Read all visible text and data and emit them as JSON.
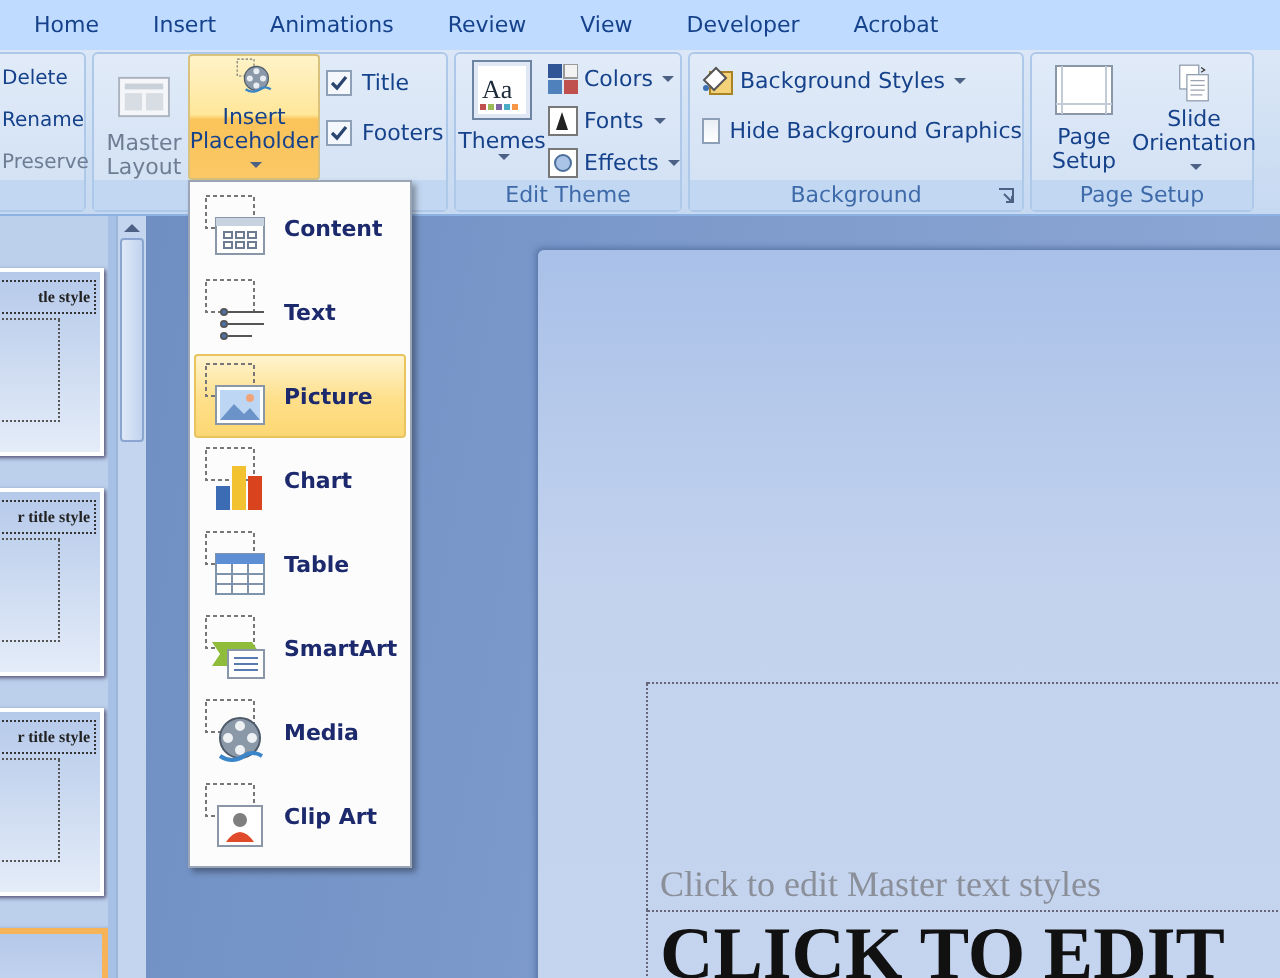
{
  "ribbon_tabs": [
    {
      "label": "Home",
      "selected": false
    },
    {
      "label": "Insert",
      "selected": false
    },
    {
      "label": "Animations",
      "selected": false
    },
    {
      "label": "Review",
      "selected": false
    },
    {
      "label": "View",
      "selected": false
    },
    {
      "label": "Developer",
      "selected": false
    },
    {
      "label": "Acrobat",
      "selected": false
    }
  ],
  "edit_master_group": {
    "buttons": [
      {
        "label": "Delete",
        "disabled": false
      },
      {
        "label": "Rename",
        "disabled": false
      },
      {
        "label": "Preserve",
        "disabled": true
      }
    ]
  },
  "master_layout_group": {
    "master_layout": {
      "label": "Master Layout",
      "disabled": true
    },
    "insert_placeholder": {
      "label": "Insert Placeholder",
      "pressed": true
    },
    "checkboxes": [
      {
        "label": "Title",
        "checked": true
      },
      {
        "label": "Footers",
        "checked": true
      }
    ]
  },
  "edit_theme_group": {
    "title": "Edit Theme",
    "themes": "Themes",
    "themes_icon_text": "Aa",
    "menus": [
      {
        "label": "Colors"
      },
      {
        "label": "Fonts"
      },
      {
        "label": "Effects"
      }
    ]
  },
  "background_group": {
    "title": "Background",
    "styles": "Background Styles",
    "hide_graphics": {
      "label": "Hide Background Graphics",
      "checked": false
    }
  },
  "page_setup_group": {
    "title": "Page Setup",
    "buttons": [
      {
        "label": "Page Setup",
        "dropdown": false
      },
      {
        "label": "Slide Orientation",
        "dropdown": true
      }
    ]
  },
  "placeholder_menu": [
    {
      "label": "Content",
      "selected": false
    },
    {
      "label": "Text",
      "selected": false
    },
    {
      "label": "Picture",
      "selected": true
    },
    {
      "label": "Chart",
      "selected": false
    },
    {
      "label": "Table",
      "selected": false
    },
    {
      "label": "SmartArt",
      "selected": false
    },
    {
      "label": "Media",
      "selected": false
    },
    {
      "label": "Clip Art",
      "selected": false
    }
  ],
  "thumbnails": [
    {
      "title": "tle style",
      "selected": false
    },
    {
      "title": "r title style",
      "selected": false
    },
    {
      "title": "r title style",
      "selected": false
    },
    {
      "selected": true
    }
  ],
  "slide": {
    "text_placeholder": "Click to edit Master text styles",
    "title": "CLICK TO EDIT"
  }
}
